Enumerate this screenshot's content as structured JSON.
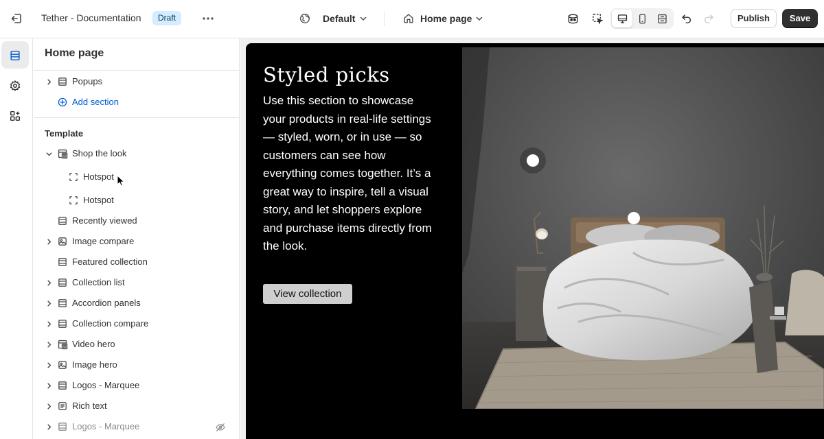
{
  "topbar": {
    "store_name": "Tether - Documentation",
    "status_badge": "Draft",
    "theme_selector": "Default",
    "page_selector": "Home page",
    "publish_label": "Publish",
    "save_label": "Save",
    "icons": [
      "exit-icon",
      "more-icon",
      "globe-icon",
      "chevron-down-icon",
      "home-icon",
      "inspector-icon",
      "select-element-icon",
      "desktop-icon",
      "mobile-icon",
      "fullwidth-icon",
      "undo-icon",
      "redo-icon"
    ]
  },
  "rail": {
    "icons": [
      "sections-icon",
      "settings-icon",
      "apps-icon"
    ],
    "selected": "sections-icon"
  },
  "panel": {
    "title": "Home page",
    "header_group": {
      "items": [
        {
          "label": "Popups",
          "icon": "section-icon",
          "expandable": true
        }
      ],
      "add_label": "Add section"
    },
    "template_heading": "Template",
    "template_items": [
      {
        "label": "Shop the look",
        "icon": "image-section-icon",
        "expandable": true,
        "expanded": true,
        "children": [
          {
            "label": "Hotspot",
            "icon": "hotspot-icon"
          },
          {
            "label": "Hotspot",
            "icon": "hotspot-icon"
          }
        ]
      },
      {
        "label": "Recently viewed",
        "icon": "section-icon",
        "expandable": false
      },
      {
        "label": "Image compare",
        "icon": "image-icon",
        "expandable": true
      },
      {
        "label": "Featured collection",
        "icon": "section-icon",
        "expandable": false
      },
      {
        "label": "Collection list",
        "icon": "section-icon",
        "expandable": true
      },
      {
        "label": "Accordion panels",
        "icon": "section-icon",
        "expandable": true
      },
      {
        "label": "Collection compare",
        "icon": "section-icon",
        "expandable": true
      },
      {
        "label": "Video hero",
        "icon": "image-section-icon",
        "expandable": true
      },
      {
        "label": "Image hero",
        "icon": "image-icon",
        "expandable": true
      },
      {
        "label": "Logos - Marquee",
        "icon": "section-icon",
        "expandable": true
      },
      {
        "label": "Rich text",
        "icon": "text-icon",
        "expandable": true
      },
      {
        "label": "Logos - Marquee",
        "icon": "section-icon",
        "expandable": true,
        "hidden": true
      }
    ]
  },
  "preview": {
    "title": "Styled picks",
    "body": "Use this section to showcase your products in real-life settings — styled, worn, or in use — so customers can see how everything comes together. It’s a great way to inspire, tell a visual story, and let shoppers explore and purchase items directly from the look.",
    "button_label": "View collection",
    "hotspot_count": 2
  },
  "colors": {
    "accent_link": "#005bd3",
    "badge_bg": "#d5ebff",
    "save_bg": "#303030",
    "preview_bg": "#000000"
  }
}
